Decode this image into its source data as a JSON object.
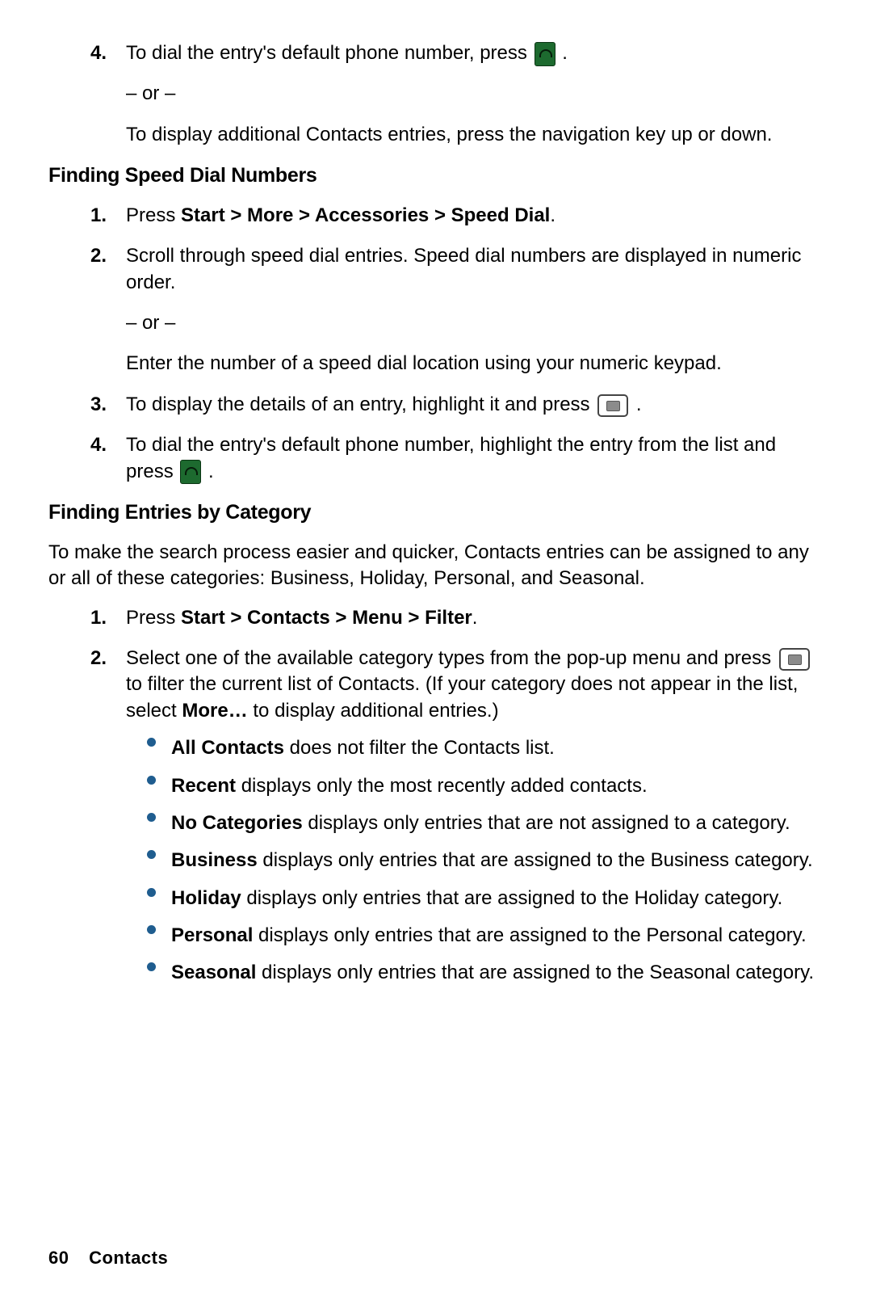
{
  "step4_prev": {
    "num": "4.",
    "text_before": "To dial the entry's default phone number, press ",
    "text_after": ".",
    "or": "– or –",
    "sub": "To display additional Contacts entries, press the navigation key up or down."
  },
  "section_speed_dial": {
    "heading": "Finding Speed Dial Numbers",
    "steps": {
      "s1": {
        "num": "1.",
        "prefix": "Press ",
        "bold": "Start > More > Accessories > Speed Dial",
        "suffix": "."
      },
      "s2": {
        "num": "2.",
        "text": "Scroll through speed dial entries. Speed dial numbers are displayed in numeric order.",
        "or": "– or –",
        "sub": "Enter the number of a speed dial location using your numeric keypad."
      },
      "s3": {
        "num": "3.",
        "text_before": "To display the details of an entry, highlight it and press ",
        "text_after": "."
      },
      "s4": {
        "num": "4.",
        "text_before": "To dial the entry's default phone number, highlight the entry from the list and press ",
        "text_after": "."
      }
    }
  },
  "section_category": {
    "heading": "Finding Entries by Category",
    "intro": "To make the search process easier and quicker, Contacts entries can be assigned to any or all of these categories: Business, Holiday, Personal, and Seasonal.",
    "steps": {
      "s1": {
        "num": "1.",
        "prefix": "Press ",
        "bold": "Start > Contacts > Menu > Filter",
        "suffix": "."
      },
      "s2": {
        "num": "2.",
        "text_before": "Select one of the available category types from the pop-up menu and press ",
        "text_mid": " to filter the current list of Contacts. (If your category does not appear in the list, select ",
        "more_bold": "More…",
        "text_after": " to display additional entries.)",
        "bullets": {
          "b1": {
            "bold": "All Contacts",
            "rest": " does not filter the Contacts list."
          },
          "b2": {
            "bold": "Recent",
            "rest": " displays only the most recently added contacts."
          },
          "b3": {
            "bold": "No Categories",
            "rest": " displays only entries that are not assigned to a category."
          },
          "b4": {
            "bold": "Business",
            "rest": " displays only entries that are assigned to the Business category."
          },
          "b5": {
            "bold": "Holiday",
            "rest": " displays only entries that are assigned to the Holiday category."
          },
          "b6": {
            "bold": "Personal",
            "rest": " displays only entries that are assigned to the Personal category."
          },
          "b7": {
            "bold": "Seasonal",
            "rest": " displays only entries that are assigned to the Seasonal category."
          }
        }
      }
    }
  },
  "footer": {
    "page_number": "60",
    "section": "Contacts"
  }
}
